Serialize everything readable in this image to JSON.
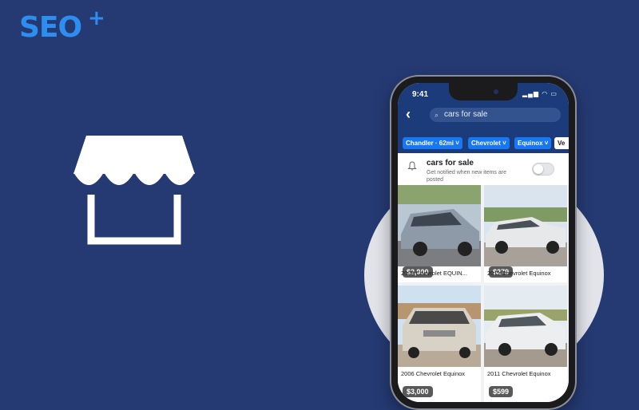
{
  "brand": {
    "logo_text": "SEO",
    "logo_plus": "+"
  },
  "colors": {
    "background": "#253a73",
    "brand_blue": "#2d8ef0",
    "facebook_blue": "#1877f2",
    "header": "#1c3b7a"
  },
  "illustration": {
    "icon": "marketplace-store-icon"
  },
  "phone": {
    "status": {
      "time": "9:41",
      "icons": "signal-wifi-battery"
    },
    "search": {
      "query": "cars for sale",
      "back_icon": "chevron-left-icon",
      "search_icon": "search-icon"
    },
    "filters": [
      {
        "label": "Chandler · 62mi",
        "icon": "chevron-down-icon"
      },
      {
        "label": "Chevrolet",
        "icon": "chevron-down-icon"
      },
      {
        "label": "Equinox",
        "icon": "chevron-down-icon"
      },
      {
        "label": "Ve"
      }
    ],
    "notification": {
      "title": "cars for sale",
      "subtitle": "Get notified when new items are posted",
      "icon": "bell-icon",
      "toggle_on": false
    },
    "listings": [
      {
        "price": "$2,900",
        "title": "2006 Chevrolet EQUIN...",
        "car_color": "#8e9aa8"
      },
      {
        "price": "$279",
        "title": "2011 Chevrolet Equinox",
        "car_color": "#e6e8ea"
      },
      {
        "price": "$3,000",
        "title": "2006 Chevrolet Equinox",
        "car_color": "#d8d2c6"
      },
      {
        "price": "$599",
        "title": "2011 Chevrolet Equinox",
        "car_color": "#eceef0"
      }
    ]
  }
}
